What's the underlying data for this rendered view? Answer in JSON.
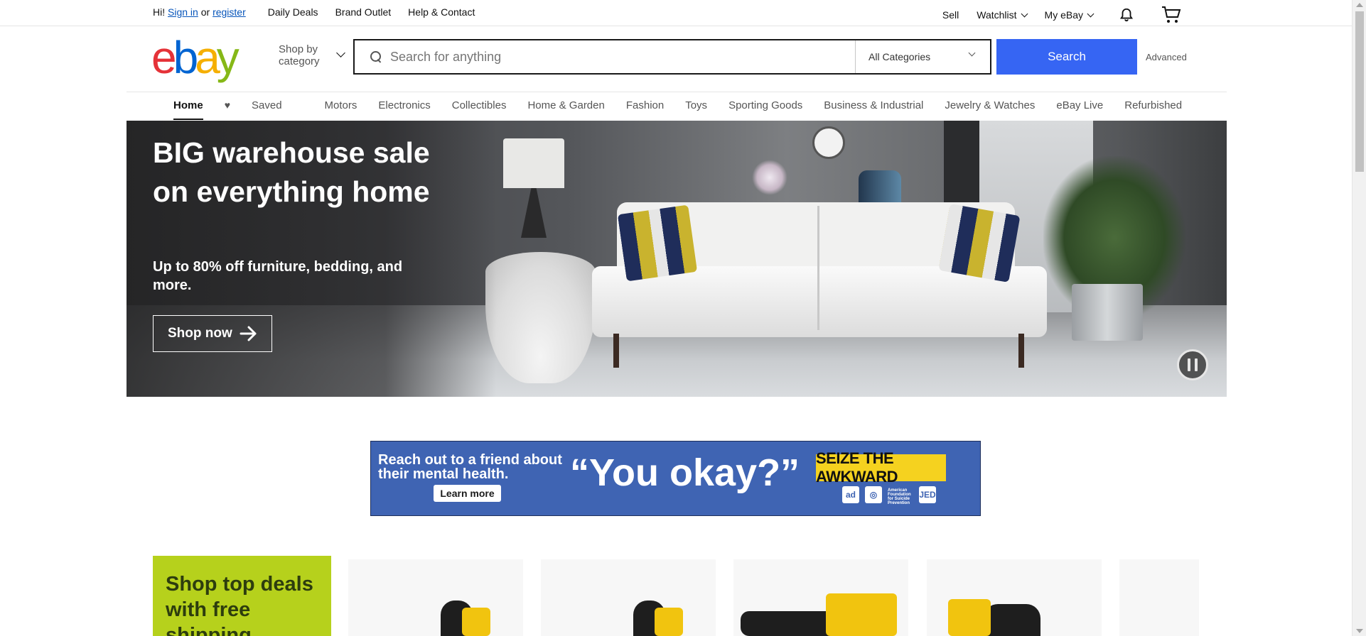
{
  "topbar": {
    "greeting_prefix": "Hi!",
    "sign_in": "Sign in",
    "or": "or",
    "register": "register",
    "daily_deals": "Daily Deals",
    "brand_outlet": "Brand Outlet",
    "help_contact": "Help & Contact",
    "sell": "Sell",
    "watchlist": "Watchlist",
    "my_ebay": "My eBay"
  },
  "header": {
    "logo": {
      "e": "e",
      "b": "b",
      "a": "a",
      "y": "y"
    },
    "shop_by_line1": "Shop by",
    "shop_by_line2": "category",
    "search_placeholder": "Search for anything",
    "category_selected": "All Categories",
    "search_button": "Search",
    "advanced": "Advanced"
  },
  "catnav": {
    "items": [
      "Home",
      "Saved",
      "Motors",
      "Electronics",
      "Collectibles",
      "Home & Garden",
      "Fashion",
      "Toys",
      "Sporting Goods",
      "Business & Industrial",
      "Jewelry & Watches",
      "eBay Live",
      "Refurbished"
    ]
  },
  "hero": {
    "title": "BIG warehouse sale on everything home",
    "subtitle": "Up to 80% off furniture, bedding, and more.",
    "cta": "Shop now"
  },
  "ad": {
    "line": "Reach out to a friend about their mental health.",
    "learn_more": "Learn more",
    "quote": "“You okay?”",
    "seize": "SEIZE THE AWKWARD",
    "ad_logo": "ad",
    "afsp_text": "American Foundation for Suicide Prevention",
    "jed": "JED"
  },
  "deals": {
    "heading": "Shop top deals with free shipping"
  },
  "colors": {
    "accent": "#3665f3",
    "deals_bg": "#b6d11c",
    "ad_bg": "#3f64b3"
  }
}
